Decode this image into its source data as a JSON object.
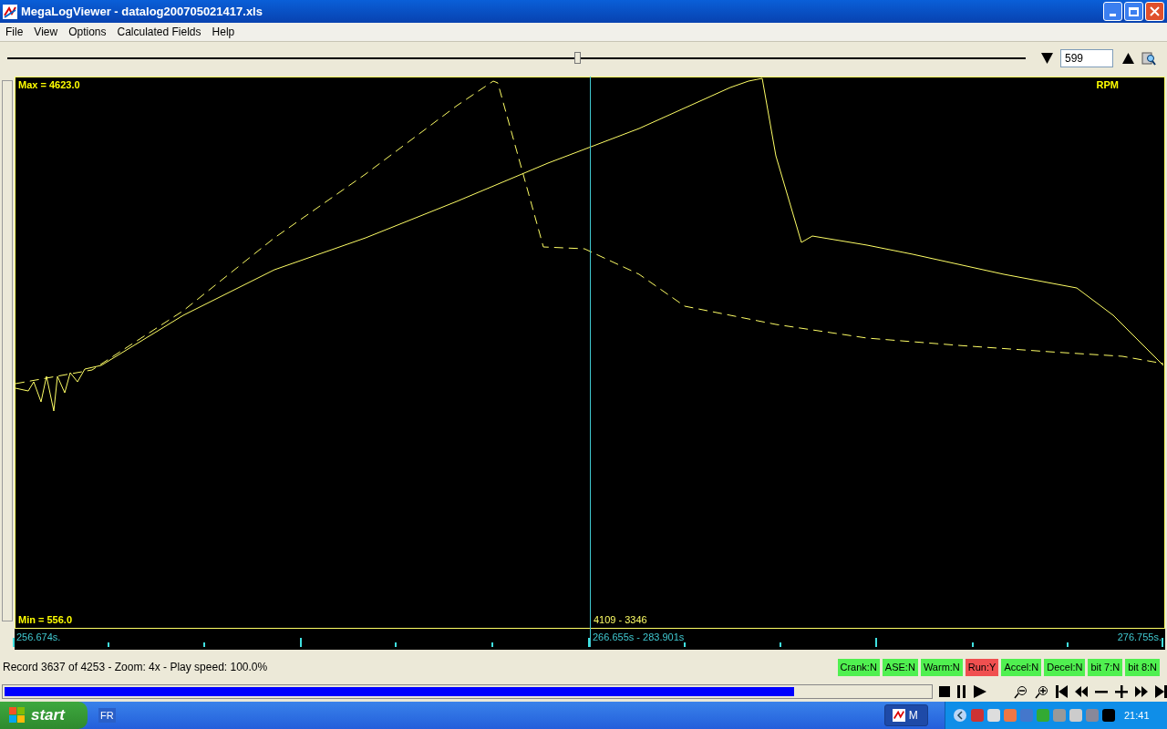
{
  "window": {
    "title": "MegaLogViewer - datalog200705021417.xls"
  },
  "menu": [
    "File",
    "View",
    "Options",
    "Calculated Fields",
    "Help"
  ],
  "toolbar": {
    "position": {
      "level": 0.56
    },
    "record_field": "599"
  },
  "chart": {
    "max_label": "Max = 4623.0",
    "min_label": "Min = 556.0",
    "channel": "RPM",
    "cursor_value": "4109 - 3346",
    "axis_start": "256.674s.",
    "axis_cursor": "266.655s - 283.901s",
    "axis_end": "276.755s."
  },
  "status": {
    "text": "Record 3637 of 4253 - Zoom: 4x - Play speed: 100.0%",
    "flags": [
      {
        "label": "Crank:N",
        "on": false
      },
      {
        "label": "ASE:N",
        "on": false
      },
      {
        "label": "Warm:N",
        "on": false
      },
      {
        "label": "Run:Y",
        "on": true
      },
      {
        "label": "Accel:N",
        "on": false
      },
      {
        "label": "Decel:N",
        "on": false
      },
      {
        "label": "bit 7:N",
        "on": false
      },
      {
        "label": "bit 8:N",
        "on": false
      }
    ]
  },
  "playback": {
    "level": 0.853
  },
  "taskbar": {
    "start": "start",
    "language": "FR",
    "task": "M",
    "clock": "21:41"
  }
}
